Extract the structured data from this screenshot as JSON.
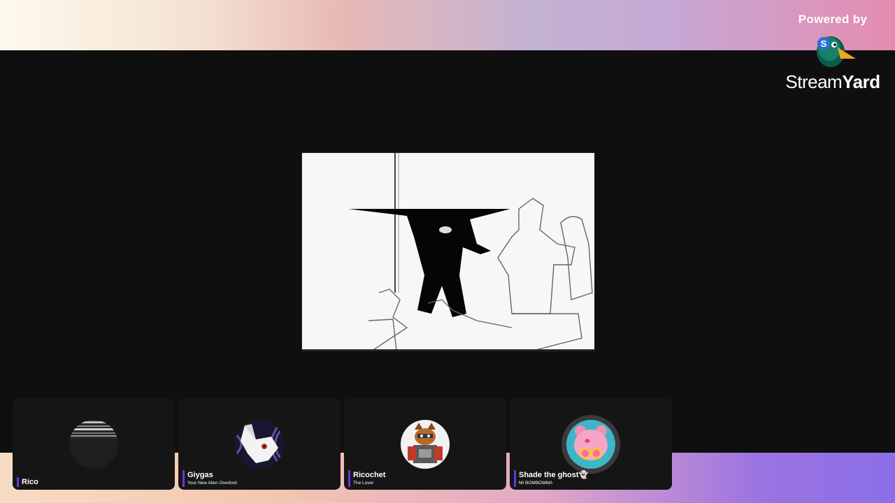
{
  "branding": {
    "powered_by": "Powered by",
    "name_light": "Stream",
    "name_bold": "Yard",
    "logo_icon": "duck-mascot-icon"
  },
  "shared_screen": {
    "description_icon": "video-frame"
  },
  "participants": [
    {
      "name": "Rico",
      "subtitle": "",
      "avatar_icon": "glitch-avatar-icon"
    },
    {
      "name": "Giygas",
      "subtitle": "Your New Alien Overlord",
      "avatar_icon": "white-fox-avatar-icon"
    },
    {
      "name": "Ricochet",
      "subtitle": "The Lover",
      "avatar_icon": "robot-raccoon-avatar-icon"
    },
    {
      "name": "Shade the ghost👻",
      "subtitle": "MI BOMBOMMA",
      "avatar_icon": "pink-bear-avatar-icon"
    }
  ],
  "colors": {
    "name_tag_accent": "#6a35d8",
    "stage_background": "#0f0f0f",
    "tile_background": "#151515"
  }
}
